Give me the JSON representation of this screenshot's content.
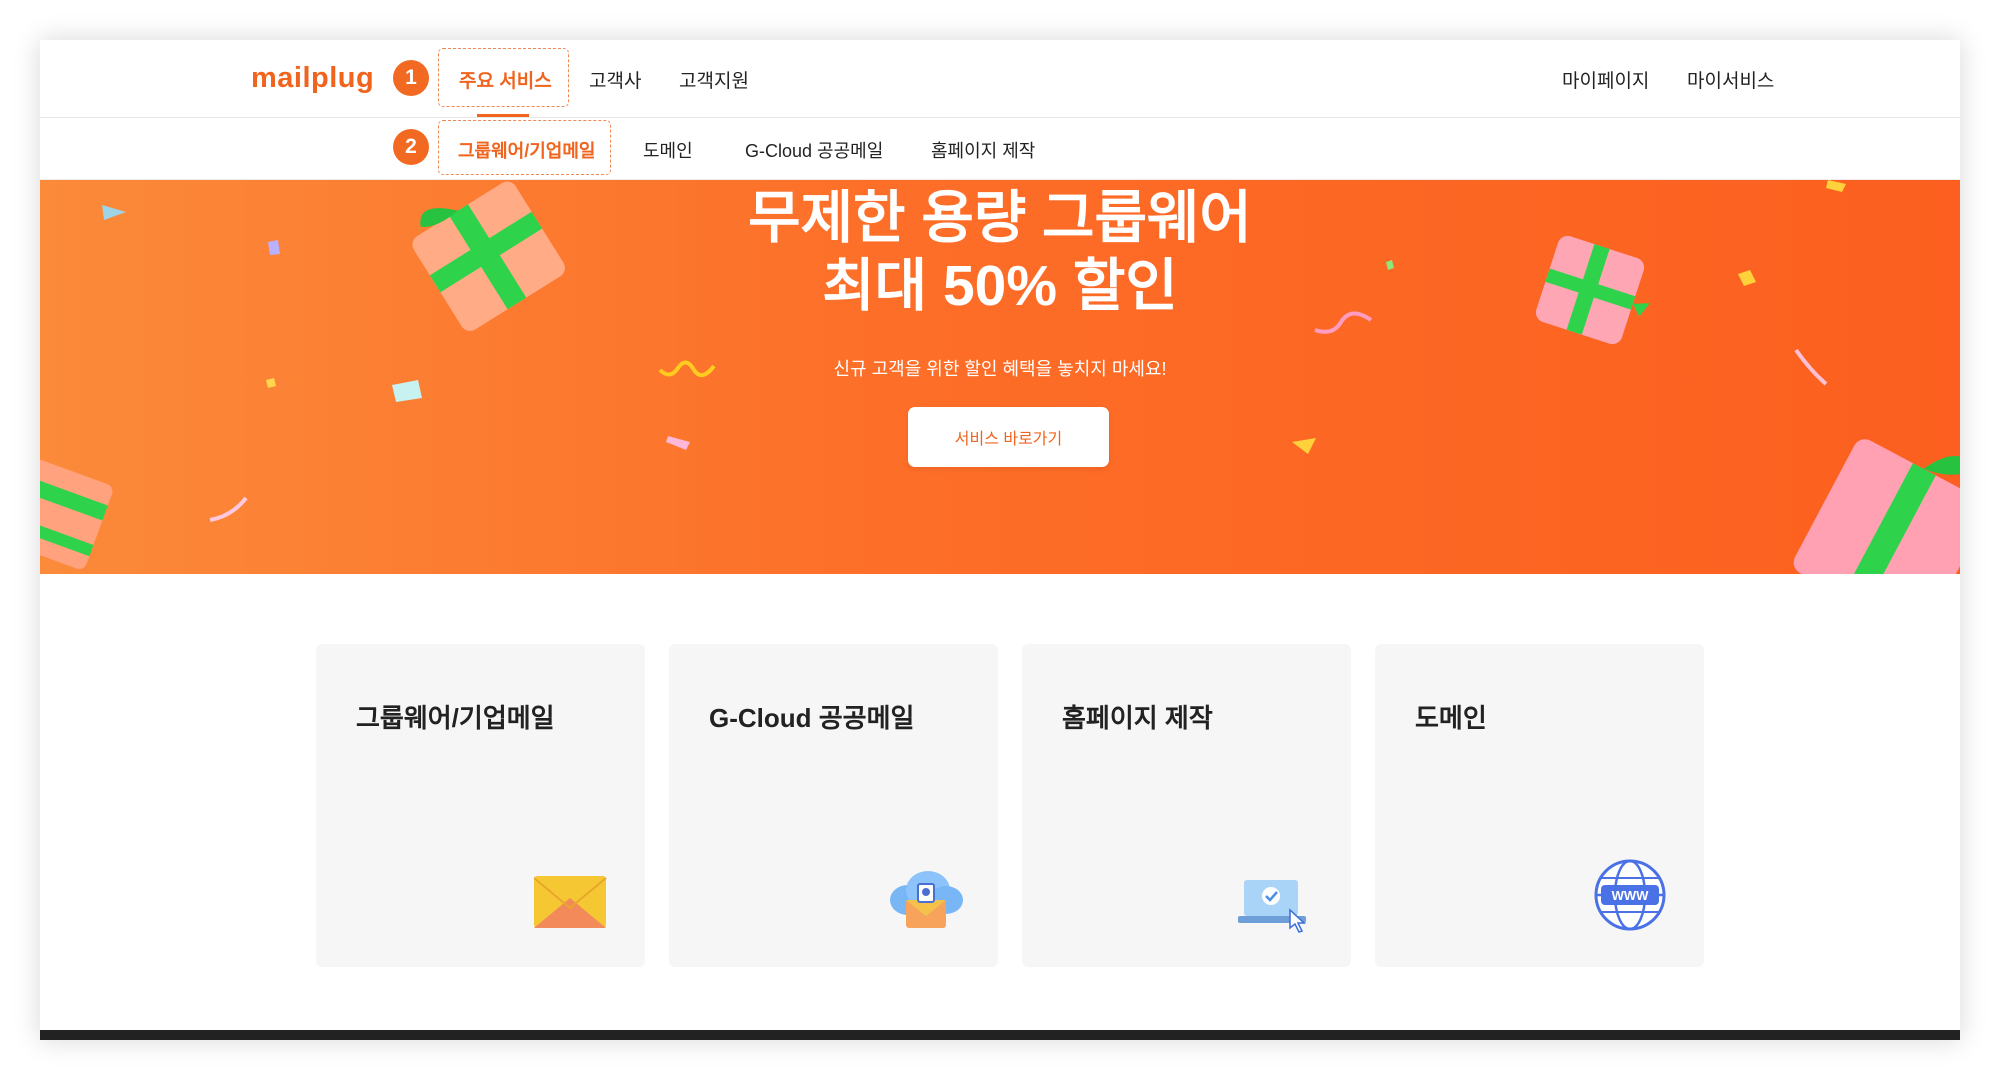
{
  "header": {
    "logo": "mailplug",
    "annotations": {
      "main_nav": "1",
      "sub_nav": "2"
    },
    "main_nav": [
      {
        "label": "주요 서비스",
        "active": true
      },
      {
        "label": "고객사",
        "active": false
      },
      {
        "label": "고객지원",
        "active": false
      }
    ],
    "right_nav": [
      {
        "label": "마이페이지"
      },
      {
        "label": "마이서비스"
      }
    ],
    "sub_nav": [
      {
        "label": "그룹웨어/기업메일",
        "active": true
      },
      {
        "label": "도메인",
        "active": false
      },
      {
        "label": "G-Cloud 공공메일",
        "active": false
      },
      {
        "label": "홈페이지 제작",
        "active": false
      }
    ]
  },
  "banner": {
    "title_line1": "무제한 용량 그룹웨어",
    "title_line2": "최대 50% 할인",
    "subtitle": "신규 고객을 위한 할인 혜택을 놓치지 마세요!",
    "button_label": "서비스 바로가기",
    "background_color": "#fd6e28"
  },
  "cards": [
    {
      "title": "그룹웨어/기업메일",
      "icon": "envelope-icon"
    },
    {
      "title": "G-Cloud 공공메일",
      "icon": "cloud-mail-icon"
    },
    {
      "title": "홈페이지 제작",
      "icon": "laptop-check-icon"
    },
    {
      "title": "도메인",
      "icon": "globe-www-icon"
    }
  ],
  "colors": {
    "accent": "#f0641e",
    "card_bg": "#f6f6f6",
    "gift_ribbon": "#2fd24b"
  },
  "globe_label": "WWW"
}
